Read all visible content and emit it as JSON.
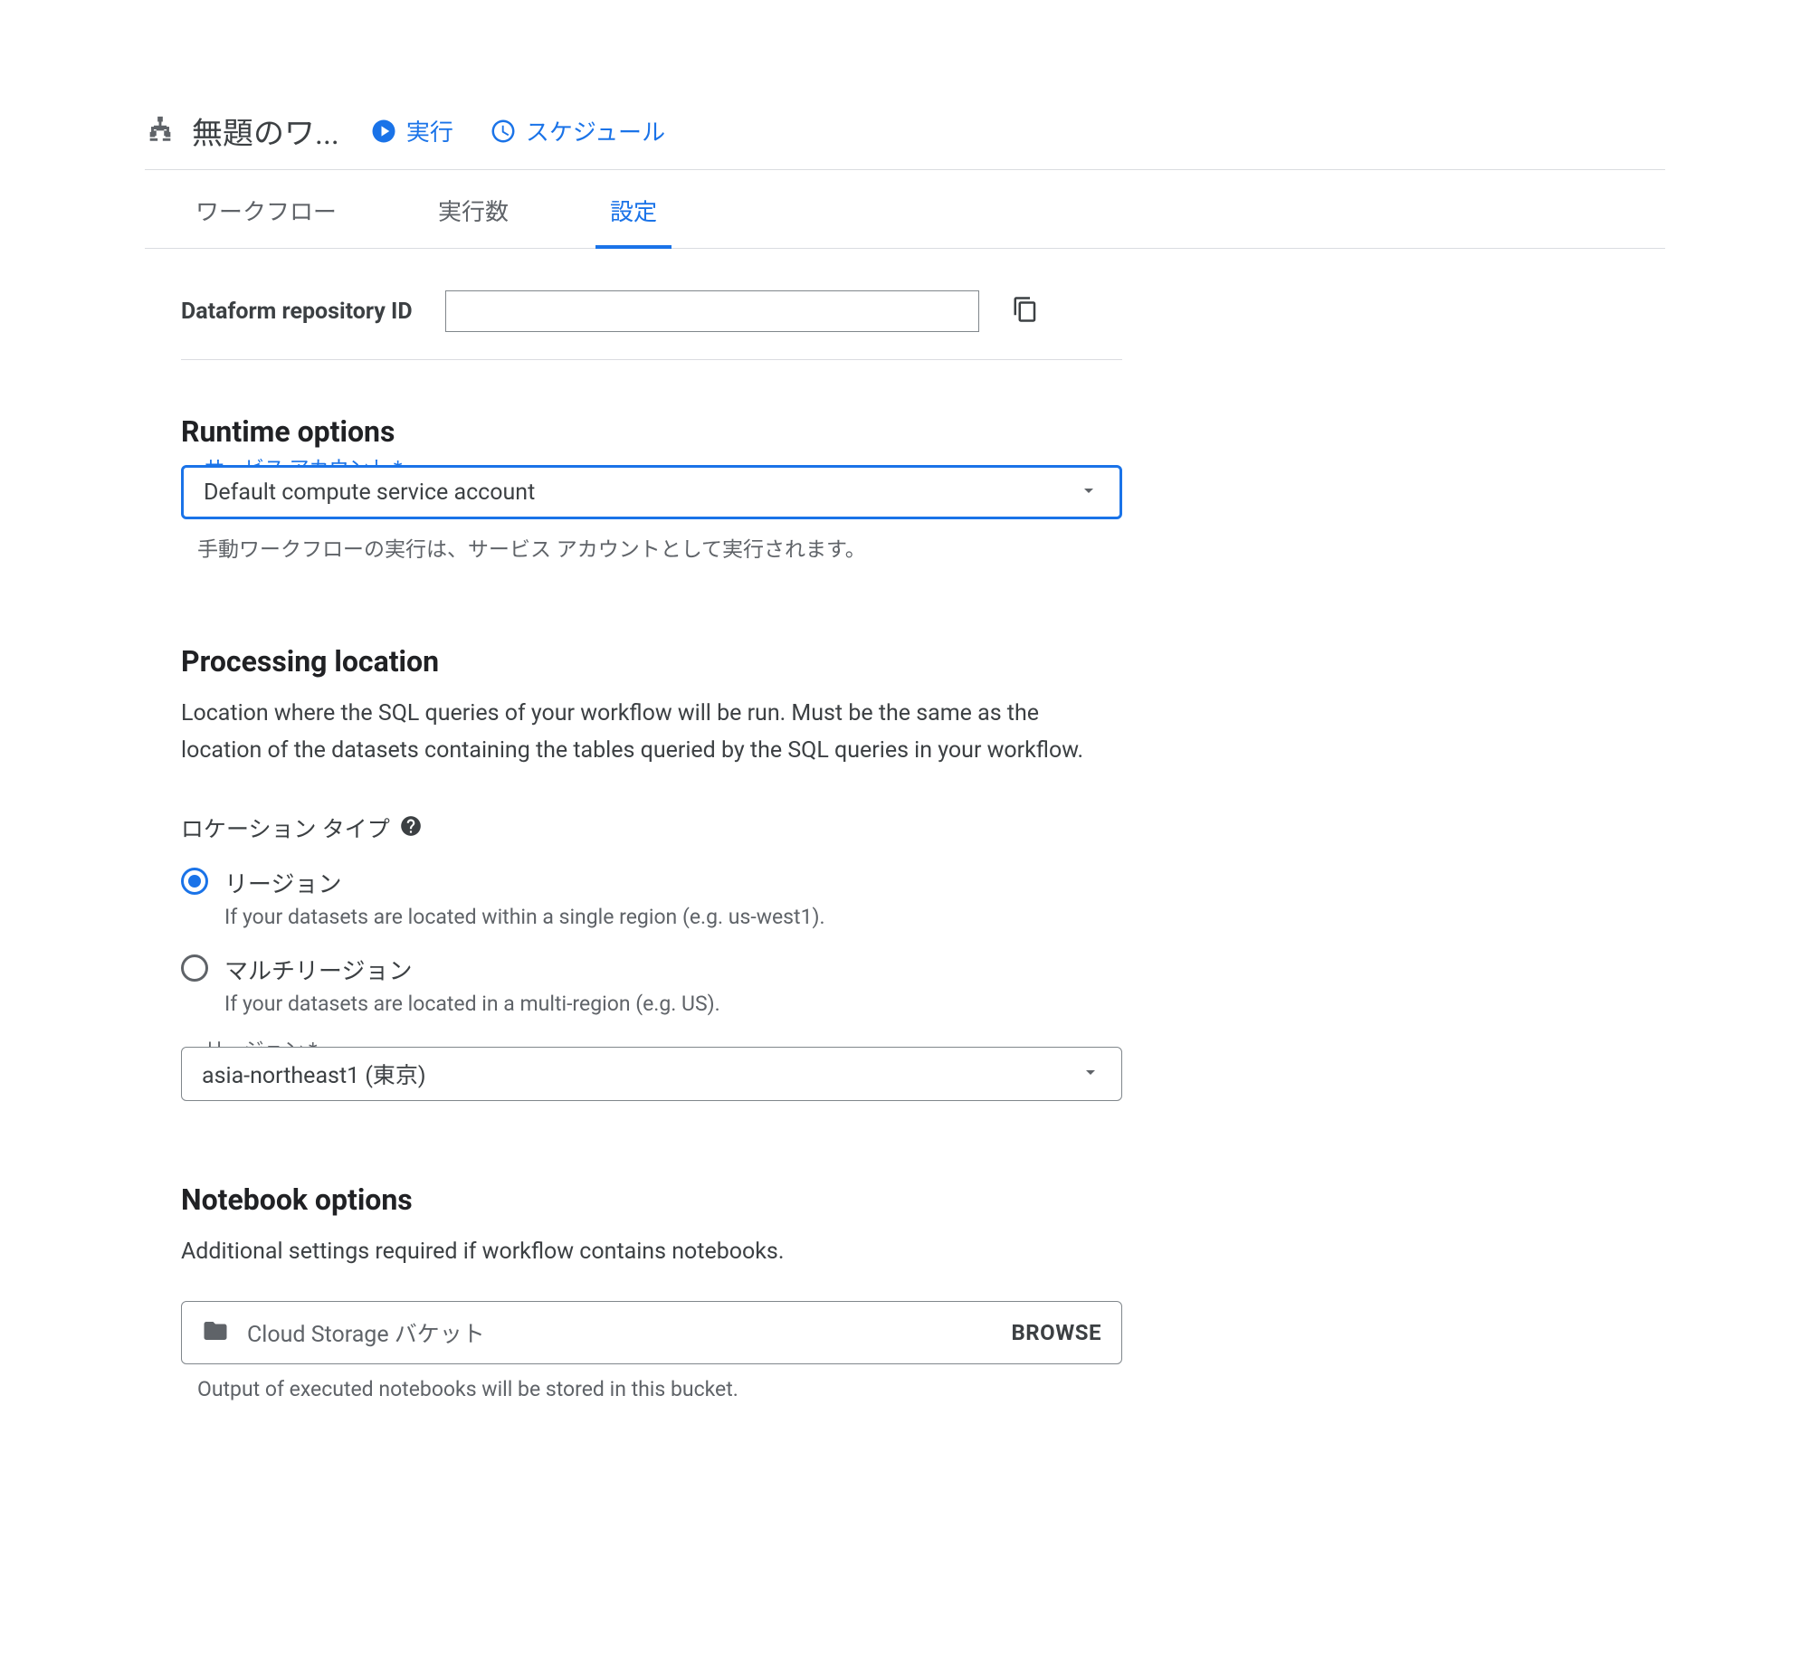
{
  "header": {
    "title": "無題のワ...",
    "actions": {
      "run": "実行",
      "schedule": "スケジュール"
    }
  },
  "tabs": {
    "workflow": "ワークフロー",
    "runs": "実行数",
    "settings": "設定"
  },
  "repo": {
    "label": "Dataform repository ID",
    "value": ""
  },
  "runtime": {
    "heading": "Runtime options",
    "service_account": {
      "label": "サービス アカウント *",
      "value": "Default compute service account",
      "help": "手動ワークフローの実行は、サービス アカウントとして実行されます。"
    }
  },
  "processing": {
    "heading": "Processing location",
    "desc": "Location where the SQL queries of your workflow will be run. Must be the same as the location of the datasets containing the tables queried by the SQL queries in your workflow.",
    "location_type_label": "ロケーション タイプ",
    "options": {
      "region": {
        "label": "リージョン",
        "desc": "If your datasets are located within a single region (e.g. us-west1).",
        "selected": true
      },
      "multi": {
        "label": "マルチリージョン",
        "desc": "If your datasets are located in a multi-region (e.g. US).",
        "selected": false
      }
    },
    "region_select": {
      "label": "リージョン *",
      "value": "asia-northeast1 (東京)"
    }
  },
  "notebook": {
    "heading": "Notebook options",
    "desc": "Additional settings required if workflow contains notebooks.",
    "bucket_placeholder": "Cloud Storage バケット",
    "browse": "BROWSE",
    "help": "Output of executed notebooks will be stored in this bucket."
  }
}
